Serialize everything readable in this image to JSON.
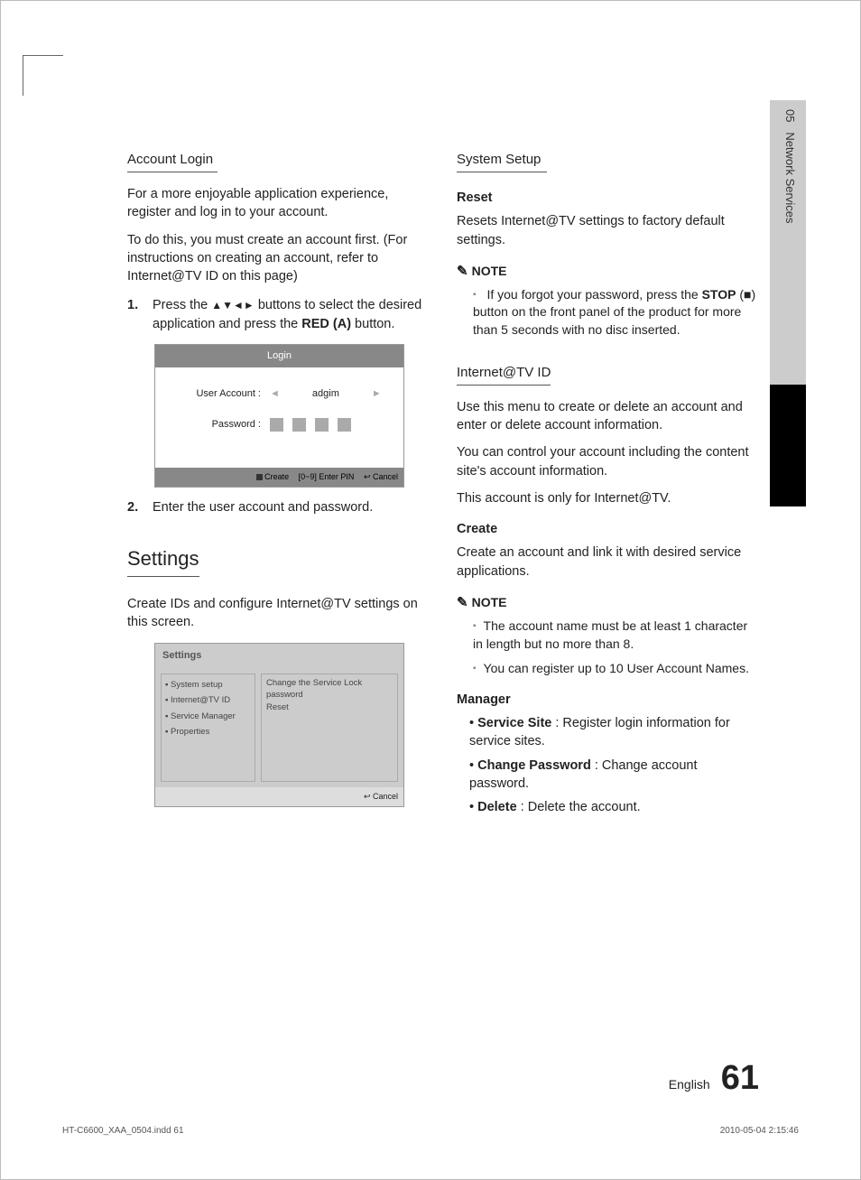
{
  "sideTab": {
    "chapter": "05",
    "label": "Network Services"
  },
  "left": {
    "h_accountLogin": "Account Login",
    "p1": "For a more enjoyable application experience, register and log in to your account.",
    "p2": "To do this, you must create an account first. (For instructions on creating an account, refer to Internet@TV ID on this page)",
    "step1_pre": "Press the ",
    "step1_mid": " buttons to select the desired application and press the ",
    "step1_bold": "RED (A)",
    "step1_post": " button.",
    "step2": "Enter the user account and password.",
    "h_settings": "Settings",
    "p3": "Create IDs and configure Internet@TV settings on this screen."
  },
  "loginBox": {
    "title": "Login",
    "userLabel": "User Account :",
    "userValue": "adgim",
    "pwLabel": "Password :",
    "footCreate": "Create",
    "footEnter": "[0~9] Enter PIN",
    "footCancel": "Cancel"
  },
  "settingsBox": {
    "title": "Settings",
    "nav1": "System setup",
    "nav2": "Internet@TV ID",
    "nav3": "Service Manager",
    "nav4": "Properties",
    "mainLine1": "Change the Service Lock password",
    "mainLine2": "Reset",
    "footCancel": "Cancel"
  },
  "right": {
    "h_systemSetup": "System Setup",
    "sub_reset": "Reset",
    "p_reset": "Resets Internet@TV settings to factory default settings.",
    "noteLabel": "NOTE",
    "note1_pre": "If you forgot your password, press the ",
    "note1_bold": "STOP",
    "note1_post": " button on the front panel of the product for more than 5 seconds with no disc inserted.",
    "h_internetId": "Internet@TV ID",
    "p_i1": "Use this menu to create or delete an account and enter or delete account information.",
    "p_i2": "You can control your account including the content site's account information.",
    "p_i3": "This account is only for Internet@TV.",
    "sub_create": "Create",
    "p_create": "Create an account and link it with desired service applications.",
    "note2a": "The account name must be at least 1 character in length but no more than 8.",
    "note2b": "You can register up to 10 User Account Names.",
    "sub_manager": "Manager",
    "m1_b": "Service Site",
    "m1_t": " : Register login information for service sites.",
    "m2_b": "Change Password",
    "m2_t": " : Change account password.",
    "m3_b": "Delete",
    "m3_t": " : Delete the account."
  },
  "footer": {
    "lang": "English",
    "page": "61",
    "metaLeft": "HT-C6600_XAA_0504.indd   61",
    "metaRight": "2010-05-04   2:15:46"
  }
}
